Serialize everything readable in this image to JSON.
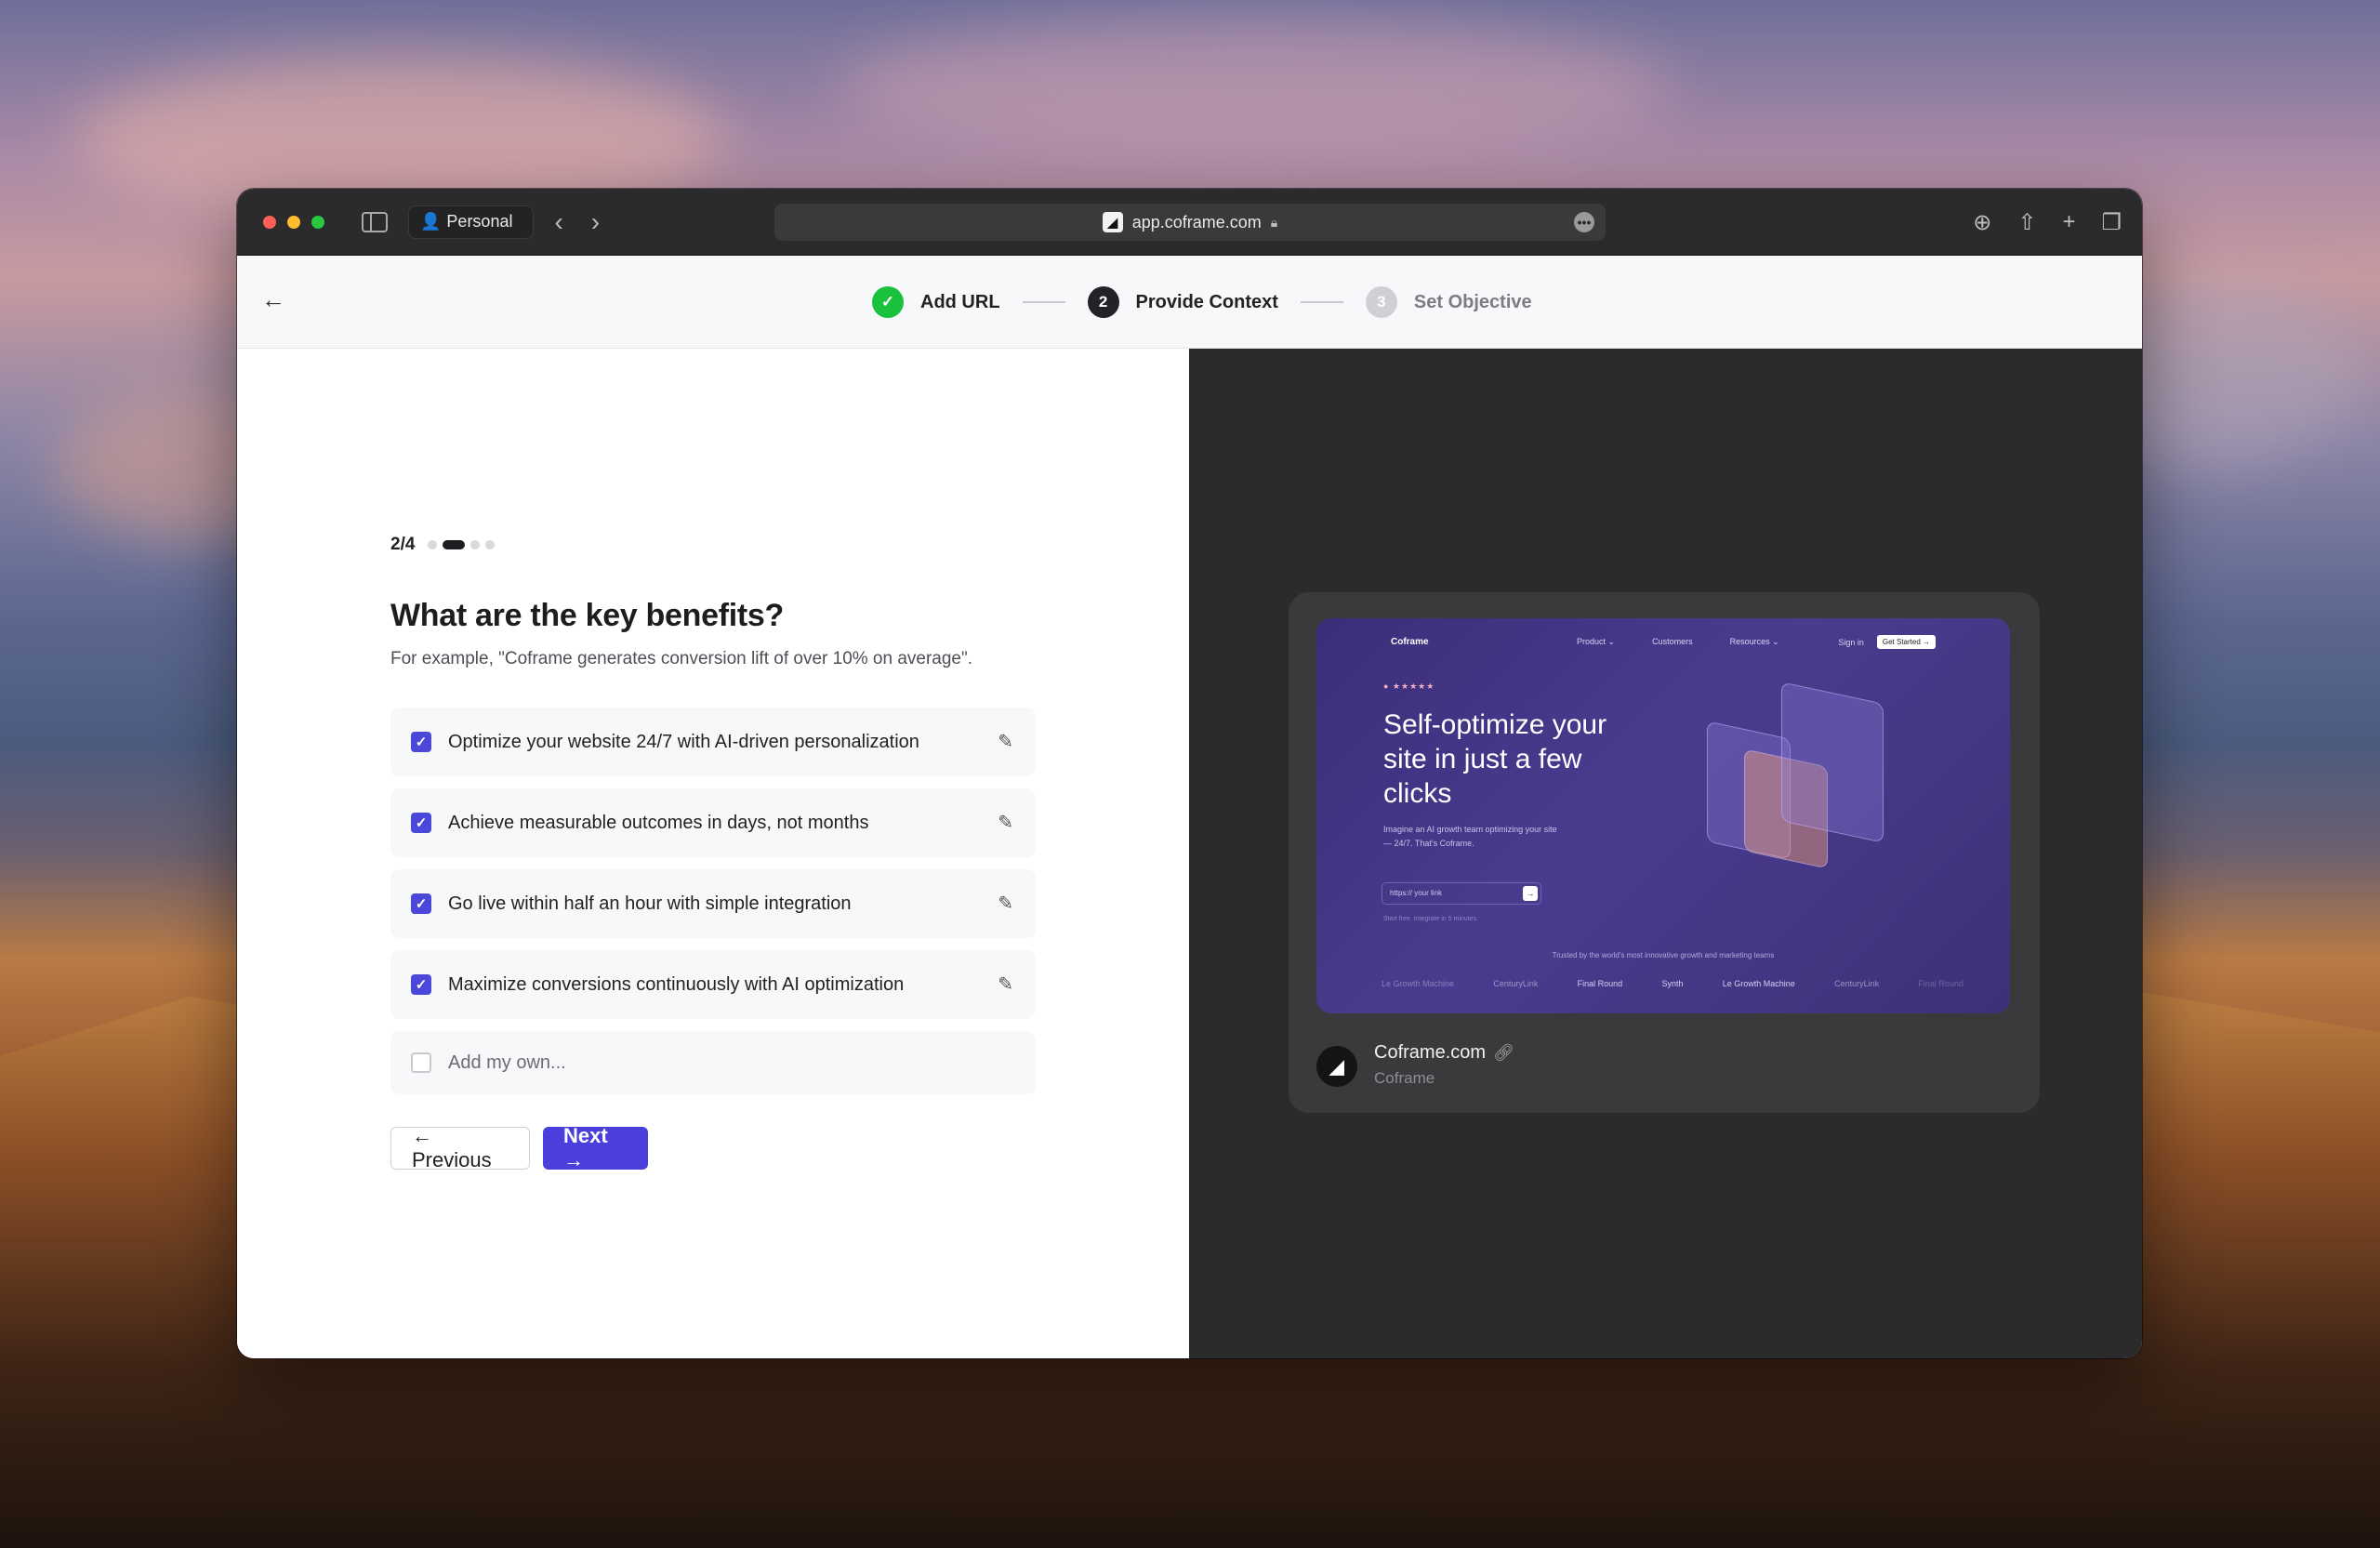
{
  "browser": {
    "profile": "Personal",
    "url": "app.coframe.com"
  },
  "stepper": {
    "steps": [
      {
        "number": "✓",
        "label": "Add URL",
        "state": "done"
      },
      {
        "number": "2",
        "label": "Provide Context",
        "state": "active"
      },
      {
        "number": "3",
        "label": "Set Objective",
        "state": "todo"
      }
    ]
  },
  "form": {
    "progress": "2/4",
    "title": "What are the key benefits?",
    "subtitle": "For example, \"Coframe generates conversion lift of over 10% on average\".",
    "options": [
      {
        "label": "Optimize your website 24/7 with AI-driven personalization",
        "checked": true
      },
      {
        "label": "Achieve measurable outcomes in days, not months",
        "checked": true
      },
      {
        "label": "Go live within half an hour with simple integration",
        "checked": true
      },
      {
        "label": "Maximize conversions continuously with AI optimization",
        "checked": true
      }
    ],
    "add_placeholder": "Add my own...",
    "previous_label": "← Previous",
    "next_label": "Next →"
  },
  "preview": {
    "nav_logo": "Coframe",
    "nav_links": [
      "Product ⌄",
      "Customers",
      "Resources ⌄"
    ],
    "nav_signin": "Sign in",
    "nav_cta": "Get Started →",
    "stars": "● ★★★★★",
    "headline": "Self-optimize your site in just a few clicks",
    "body": "Imagine an AI growth team optimizing your site — 24/7. That's Coframe.",
    "input_placeholder": "https:// your link",
    "small_note": "Start free. Integrate in 5 minutes.",
    "trusted": "Trusted by the world's most innovative growth and marketing teams",
    "logos": [
      "Le Growth Machine",
      "CenturyLink",
      "Final Round",
      "Synth",
      "Le Growth Machine",
      "CenturyLink",
      "Final Round"
    ],
    "site_name": "Coframe.com",
    "site_sub": "Coframe"
  }
}
